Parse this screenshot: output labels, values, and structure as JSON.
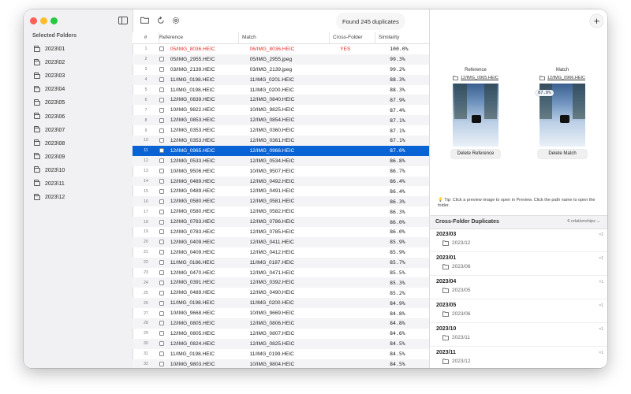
{
  "sidebar": {
    "title": "Selected Folders",
    "folders": [
      "2023\\01",
      "2023\\02",
      "2023\\03",
      "2023\\04",
      "2023\\05",
      "2023\\06",
      "2023\\07",
      "2023\\08",
      "2023\\09",
      "2023\\10",
      "2023\\11",
      "2023\\12"
    ]
  },
  "toolbar": {
    "status": "Found 245 duplicates",
    "icons": [
      "sidebar-toggle-icon",
      "folder-icon",
      "refresh-icon",
      "gear-icon",
      "plus-icon"
    ]
  },
  "table": {
    "headers": {
      "num": "#",
      "reference": "Reference",
      "match": "Match",
      "cross": "Cross-Folder",
      "similarity": "Similarity"
    },
    "rows": [
      {
        "n": "1",
        "ref": "05/IMG_8036.HEIC",
        "match": "06/IMG_8036.HEIC",
        "cross": "YES",
        "sim": "100.0%"
      },
      {
        "n": "2",
        "ref": "05/IMG_2955.HEIC",
        "match": "05/IMG_2955.jpeg",
        "cross": "",
        "sim": "99.3%"
      },
      {
        "n": "3",
        "ref": "03/IMG_2139.HEIC",
        "match": "03/IMG_2139.jpeg",
        "cross": "",
        "sim": "99.2%"
      },
      {
        "n": "4",
        "ref": "11/IMG_0198.HEIC",
        "match": "11/IMG_0201.HEIC",
        "cross": "",
        "sim": "88.3%"
      },
      {
        "n": "5",
        "ref": "11/IMG_0198.HEIC",
        "match": "11/IMG_0200.HEIC",
        "cross": "",
        "sim": "88.3%"
      },
      {
        "n": "6",
        "ref": "12/IMG_0839.HEIC",
        "match": "12/IMG_0840.HEIC",
        "cross": "",
        "sim": "87.9%"
      },
      {
        "n": "7",
        "ref": "10/IMG_9822.HEIC",
        "match": "10/IMG_9825.HEIC",
        "cross": "",
        "sim": "87.4%"
      },
      {
        "n": "8",
        "ref": "12/IMG_0853.HEIC",
        "match": "12/IMG_0854.HEIC",
        "cross": "",
        "sim": "87.1%"
      },
      {
        "n": "9",
        "ref": "12/IMG_0353.HEIC",
        "match": "12/IMG_0360.HEIC",
        "cross": "",
        "sim": "87.1%"
      },
      {
        "n": "10",
        "ref": "12/IMG_0353.HEIC",
        "match": "12/IMG_0361.HEIC",
        "cross": "",
        "sim": "87.1%"
      },
      {
        "n": "11",
        "ref": "12/IMG_0965.HEIC",
        "match": "12/IMG_0966.HEIC",
        "cross": "",
        "sim": "87.0%"
      },
      {
        "n": "12",
        "ref": "12/IMG_0533.HEIC",
        "match": "12/IMG_0534.HEIC",
        "cross": "",
        "sim": "86.8%"
      },
      {
        "n": "13",
        "ref": "10/IMG_9506.HEIC",
        "match": "10/IMG_9507.HEIC",
        "cross": "",
        "sim": "86.7%"
      },
      {
        "n": "14",
        "ref": "12/IMG_0489.HEIC",
        "match": "12/IMG_0492.HEIC",
        "cross": "",
        "sim": "86.4%"
      },
      {
        "n": "15",
        "ref": "12/IMG_0489.HEIC",
        "match": "12/IMG_0491.HEIC",
        "cross": "",
        "sim": "86.4%"
      },
      {
        "n": "16",
        "ref": "12/IMG_0580.HEIC",
        "match": "12/IMG_0581.HEIC",
        "cross": "",
        "sim": "86.3%"
      },
      {
        "n": "17",
        "ref": "12/IMG_0580.HEIC",
        "match": "12/IMG_0582.HEIC",
        "cross": "",
        "sim": "86.3%"
      },
      {
        "n": "18",
        "ref": "12/IMG_0783.HEIC",
        "match": "12/IMG_0786.HEIC",
        "cross": "",
        "sim": "86.0%"
      },
      {
        "n": "19",
        "ref": "12/IMG_0783.HEIC",
        "match": "12/IMG_0785.HEIC",
        "cross": "",
        "sim": "86.0%"
      },
      {
        "n": "20",
        "ref": "12/IMG_0409.HEIC",
        "match": "12/IMG_0411.HEIC",
        "cross": "",
        "sim": "85.9%"
      },
      {
        "n": "21",
        "ref": "12/IMG_0409.HEIC",
        "match": "12/IMG_0412.HEIC",
        "cross": "",
        "sim": "85.9%"
      },
      {
        "n": "22",
        "ref": "11/IMG_0186.HEIC",
        "match": "11/IMG_0187.HEIC",
        "cross": "",
        "sim": "85.7%"
      },
      {
        "n": "23",
        "ref": "12/IMG_0470.HEIC",
        "match": "12/IMG_0471.HEIC",
        "cross": "",
        "sim": "85.5%"
      },
      {
        "n": "24",
        "ref": "12/IMG_0391.HEIC",
        "match": "12/IMG_0392.HEIC",
        "cross": "",
        "sim": "85.3%"
      },
      {
        "n": "25",
        "ref": "12/IMG_0489.HEIC",
        "match": "12/IMG_0490.HEIC",
        "cross": "",
        "sim": "85.2%"
      },
      {
        "n": "26",
        "ref": "11/IMG_0198.HEIC",
        "match": "11/IMG_0200.HEIC",
        "cross": "",
        "sim": "84.9%"
      },
      {
        "n": "27",
        "ref": "10/IMG_9668.HEIC",
        "match": "10/IMG_9669.HEIC",
        "cross": "",
        "sim": "84.8%"
      },
      {
        "n": "28",
        "ref": "12/IMG_0805.HEIC",
        "match": "12/IMG_0806.HEIC",
        "cross": "",
        "sim": "84.8%"
      },
      {
        "n": "29",
        "ref": "12/IMG_0805.HEIC",
        "match": "12/IMG_0807.HEIC",
        "cross": "",
        "sim": "84.6%"
      },
      {
        "n": "30",
        "ref": "12/IMG_0824.HEIC",
        "match": "12/IMG_0825.HEIC",
        "cross": "",
        "sim": "84.5%"
      },
      {
        "n": "31",
        "ref": "11/IMG_0198.HEIC",
        "match": "11/IMG_0199.HEIC",
        "cross": "",
        "sim": "84.5%"
      },
      {
        "n": "32",
        "ref": "10/IMG_9803.HEIC",
        "match": "10/IMG_9804.HEIC",
        "cross": "",
        "sim": "84.5%"
      }
    ],
    "selected_row": 11,
    "highlight_row": 1
  },
  "preview": {
    "reference_label": "Reference",
    "match_label": "Match",
    "reference_path": "12/IMG_0965.HEIC",
    "match_path": "12/IMG_0966.HEIC",
    "similarity_badge": "87.0%",
    "delete_reference": "Delete Reference",
    "delete_match": "Delete Match",
    "tip": "Tip: Click a preview image to open in Preview. Click the path name to open the folder."
  },
  "cross_folder": {
    "title": "Cross-Folder Duplicates",
    "count": "6 relationships",
    "items": [
      {
        "from": "2023/03",
        "to": "2023/12",
        "n": "×2"
      },
      {
        "from": "2023/01",
        "to": "2023/06",
        "n": "×1"
      },
      {
        "from": "2023/04",
        "to": "2023/05",
        "n": "×1"
      },
      {
        "from": "2023/05",
        "to": "2023/06",
        "n": "×1"
      },
      {
        "from": "2023/10",
        "to": "2023/11",
        "n": "×1"
      },
      {
        "from": "2023/11",
        "to": "2023/12",
        "n": "×1"
      }
    ]
  },
  "colors": {
    "selection": "#0a63d4",
    "cross_folder_text": "#e0322c"
  }
}
